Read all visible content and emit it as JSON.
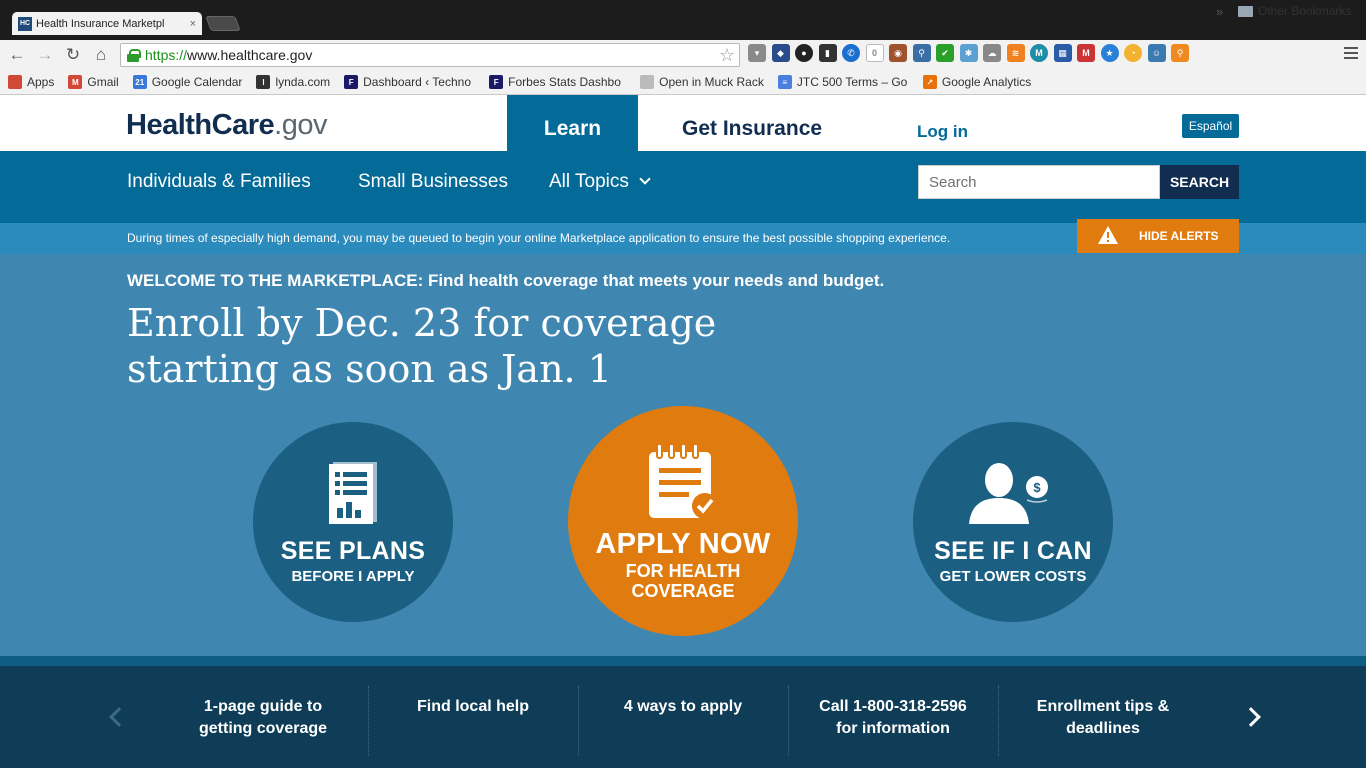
{
  "browser": {
    "tab_title": "Health Insurance Marketpl",
    "tab_favicon": "HC",
    "tab_close": "×",
    "url_scheme": "https://",
    "url_rest": "www.healthcare.gov",
    "bookmarks": [
      {
        "label": "Apps",
        "icon": "apps-grid-icon",
        "color": "#d14836",
        "glyph": ""
      },
      {
        "label": "Gmail",
        "icon": "gmail-icon",
        "color": "#d14836",
        "glyph": "M"
      },
      {
        "label": "Google Calendar",
        "icon": "calendar-icon",
        "color": "#3a78d8",
        "glyph": "21"
      },
      {
        "label": "lynda.com",
        "icon": "lynda-icon",
        "color": "#333333",
        "glyph": "l"
      },
      {
        "label": "Dashboard ‹ Techno",
        "icon": "forbes-icon",
        "color": "#1a1a66",
        "glyph": "F"
      },
      {
        "label": "Forbes Stats Dashbo",
        "icon": "forbes-icon",
        "color": "#1a1a66",
        "glyph": "F"
      },
      {
        "label": "Open in Muck Rack",
        "icon": "page-icon",
        "color": "#bbbbbb",
        "glyph": ""
      },
      {
        "label": "JTC 500 Terms – Go",
        "icon": "docs-icon",
        "color": "#4a7fe0",
        "glyph": "≡"
      },
      {
        "label": "Google Analytics",
        "icon": "analytics-icon",
        "color": "#e8710a",
        "glyph": "↗"
      }
    ],
    "bookmarks_overflow": "»",
    "other_bookmarks": "Other Bookmarks"
  },
  "header": {
    "logo_health": "Health",
    "logo_care": "Care",
    "logo_gov": ".gov",
    "tab_learn": "Learn",
    "tab_get_insurance": "Get Insurance",
    "login": "Log in",
    "espanol": "Español"
  },
  "subnav": {
    "items": [
      "Individuals & Families",
      "Small Businesses",
      "All Topics"
    ],
    "search_placeholder": "Search",
    "search_button": "SEARCH"
  },
  "alert": {
    "text": "During times of especially high demand, you may be queued to begin your online Marketplace application to ensure the best possible shopping experience.",
    "hide_label": "HIDE ALERTS"
  },
  "hero": {
    "welcome": "WELCOME TO THE MARKETPLACE: Find health coverage that meets your needs and budget.",
    "headline_line1": "Enroll by Dec. 23 for coverage",
    "headline_line2": "starting as soon as Jan. 1",
    "cta": [
      {
        "main": "SEE PLANS",
        "sub1": "BEFORE I APPLY",
        "sub2": ""
      },
      {
        "main": "APPLY NOW",
        "sub1": "FOR HEALTH",
        "sub2": "COVERAGE"
      },
      {
        "main": "SEE IF I CAN",
        "sub1": "GET LOWER COSTS",
        "sub2": ""
      }
    ]
  },
  "carousel": {
    "items": [
      "1-page guide to getting coverage",
      "Find local help",
      "4 ways to apply",
      "Call 1-800-318-2596 for information",
      "Enrollment tips & deadlines"
    ]
  },
  "colors": {
    "brand_blue": "#046b99",
    "navy": "#112e51",
    "orange": "#e07c0f",
    "hero_blue": "#3f86b0"
  }
}
